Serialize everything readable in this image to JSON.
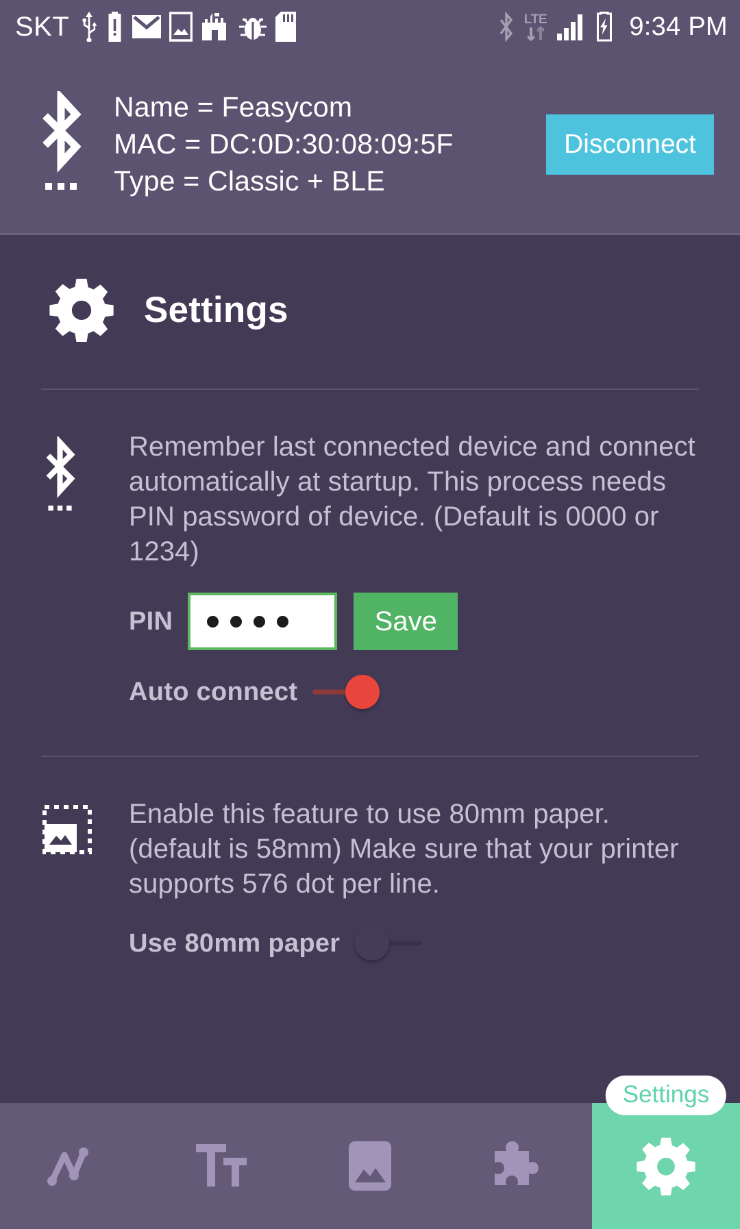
{
  "statusbar": {
    "carrier": "SKT",
    "time": "9:34 PM",
    "network_type": "LTE",
    "left_icons": [
      "usb-icon",
      "battery-alert-icon",
      "gmail-icon",
      "image-icon",
      "castle-icon",
      "bug-icon",
      "sdcard-icon"
    ],
    "right_icons": [
      "bluetooth-icon",
      "lte-icon",
      "signal-bars-icon",
      "battery-charging-icon"
    ]
  },
  "device_header": {
    "icon": "bluetooth-icon",
    "name_line": "Name = Feasycom",
    "mac_line": "MAC = DC:0D:30:08:09:5F",
    "type_line": "Type = Classic + BLE",
    "disconnect_label": "Disconnect",
    "disconnect_color": "#4ec3dd",
    "background_color": "#5c5370"
  },
  "page": {
    "title": "Settings",
    "title_icon": "gear-icon",
    "background_color": "#433a56"
  },
  "settings": [
    {
      "icon": "bluetooth-icon",
      "description": "Remember last connected device and connect automatically at startup. This process needs PIN password of device. (Default is 0000 or 1234)",
      "pin_label": "PIN",
      "pin_value": "····",
      "pin_dot_count": 4,
      "pin_border_color": "#5cb85c",
      "save_label": "Save",
      "save_color": "#51b364",
      "toggle_label": "Auto connect",
      "toggle_state": "on",
      "toggle_color": "#e8453c"
    },
    {
      "icon": "image-dashed-icon",
      "description": "Enable this feature to use 80mm paper. (default is 58mm) Make sure that your printer supports 576 dot per line.",
      "toggle_label": "Use 80mm paper",
      "toggle_state": "off",
      "toggle_color": "#453c59"
    }
  ],
  "navbar": {
    "background_color": "#635a78",
    "active_color": "#6fd5ad",
    "active_tooltip": "Settings",
    "items": [
      {
        "icon": "line-chart-icon",
        "name": "chart"
      },
      {
        "icon": "text-size-icon",
        "name": "text"
      },
      {
        "icon": "image-icon",
        "name": "image"
      },
      {
        "icon": "puzzle-piece-icon",
        "name": "plugin"
      },
      {
        "icon": "gear-icon",
        "name": "settings"
      }
    ]
  }
}
